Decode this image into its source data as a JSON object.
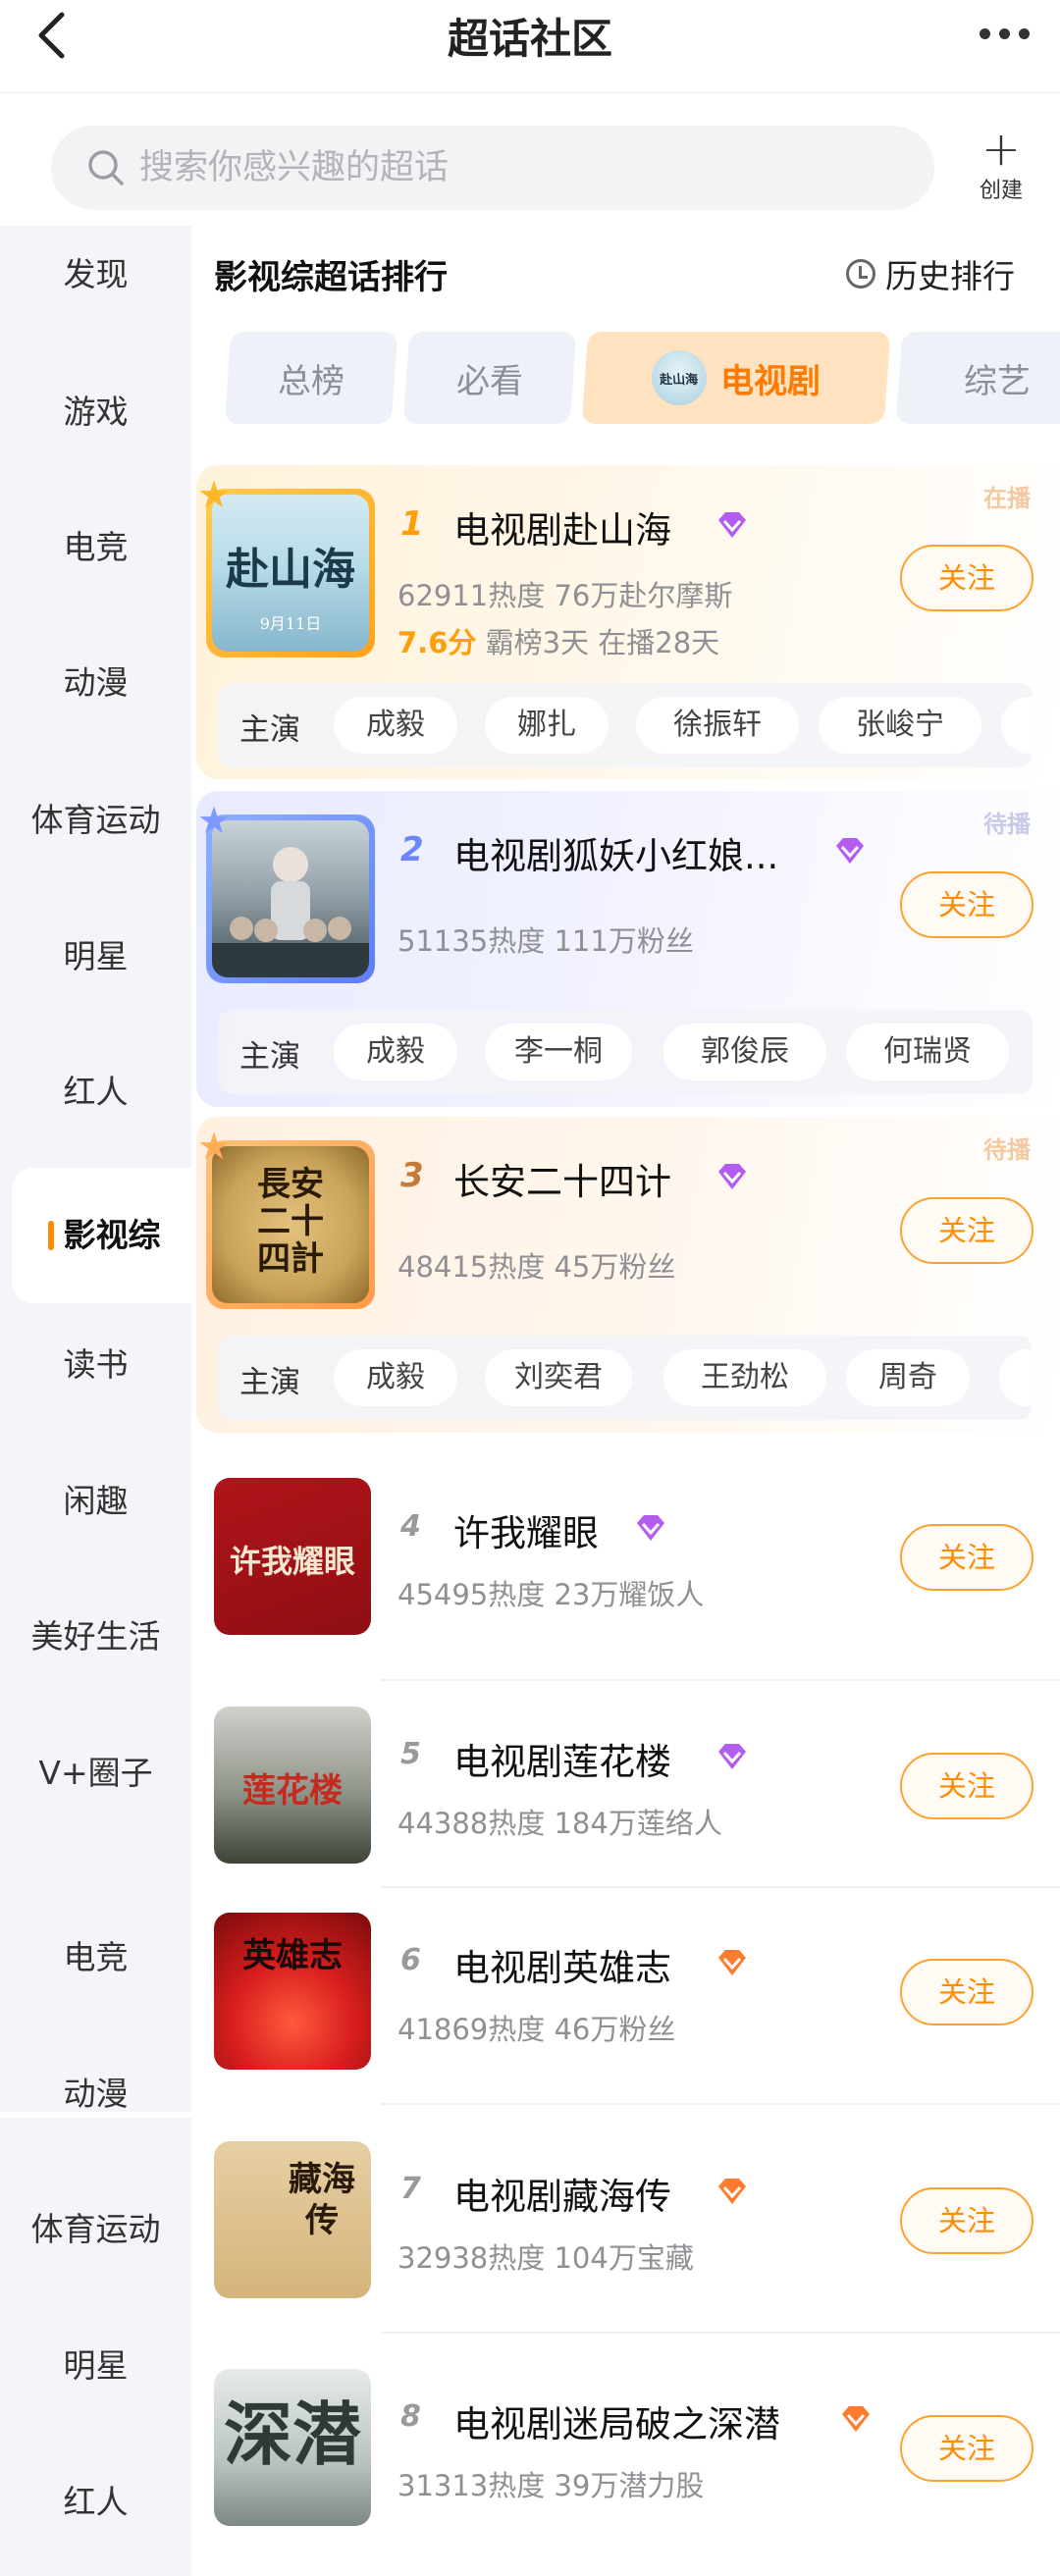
{
  "header": {
    "title": "超话社区"
  },
  "search": {
    "placeholder": "搜索你感兴趣的超话",
    "create_label": "创建"
  },
  "sidebar": {
    "items": [
      "发现",
      "游戏",
      "电竞",
      "动漫",
      "体育运动",
      "明星",
      "红人",
      "影视综",
      "读书",
      "闲趣",
      "美好生活",
      "V+圈子"
    ],
    "active_item": "影视综",
    "items_repeat": [
      "电竞",
      "动漫",
      "体育运动",
      "明星",
      "红人"
    ]
  },
  "section": {
    "title": "影视综超话排行",
    "history_label": "历史排行"
  },
  "tabs": [
    {
      "label": "总榜"
    },
    {
      "label": "必看"
    },
    {
      "label": "电视剧",
      "active": true,
      "icon_text": "赴山海"
    },
    {
      "label": "综艺"
    }
  ],
  "follow_label": "关注",
  "cast_label": "主演",
  "ranks": [
    {
      "rank": "1",
      "name": "电视剧赴山海",
      "stats": "62911热度 76万赴尔摩斯",
      "score": "7.6分",
      "extra": "霸榜3天  在播28天",
      "status": "在播",
      "cast": [
        "成毅",
        "娜扎",
        "徐振轩",
        "张峻宁"
      ],
      "cover_text": "赴山海",
      "cover_sub": "9月11日"
    },
    {
      "rank": "2",
      "name": "电视剧狐妖小红娘...",
      "stats": "51135热度 111万粉丝",
      "status": "待播",
      "cast": [
        "成毅",
        "李一桐",
        "郭俊辰",
        "何瑞贤"
      ]
    },
    {
      "rank": "3",
      "name": "长安二十四计",
      "stats": "48415热度 45万粉丝",
      "status": "待播",
      "cast": [
        "成毅",
        "刘奕君",
        "王劲松",
        "周奇"
      ],
      "cover_text": "長安二十四計"
    },
    {
      "rank": "4",
      "name": "许我耀眼",
      "stats": "45495热度 23万耀饭人",
      "cover_text": "许我耀眼"
    },
    {
      "rank": "5",
      "name": "电视剧莲花楼",
      "stats": "44388热度 184万莲络人",
      "cover_text": "莲花楼"
    },
    {
      "rank": "6",
      "name": "电视剧英雄志",
      "stats": "41869热度 46万粉丝",
      "cover_text": "英雄志"
    },
    {
      "rank": "7",
      "name": "电视剧藏海传",
      "stats": "32938热度 104万宝藏",
      "cover_text": "藏海传"
    },
    {
      "rank": "8",
      "name": "电视剧迷局破之深潜",
      "stats": "31313热度 39万潜力股",
      "cover_text": "深潜"
    }
  ],
  "colors": {
    "accent": "#ff8c00",
    "rank1": "#ff9d0a",
    "rank2": "#6b86f5",
    "rank3": "#e89549",
    "rank_other": "#9a9a9e",
    "gem_purple": "#b55cf0",
    "gem_orange": "#ff7b2e"
  }
}
